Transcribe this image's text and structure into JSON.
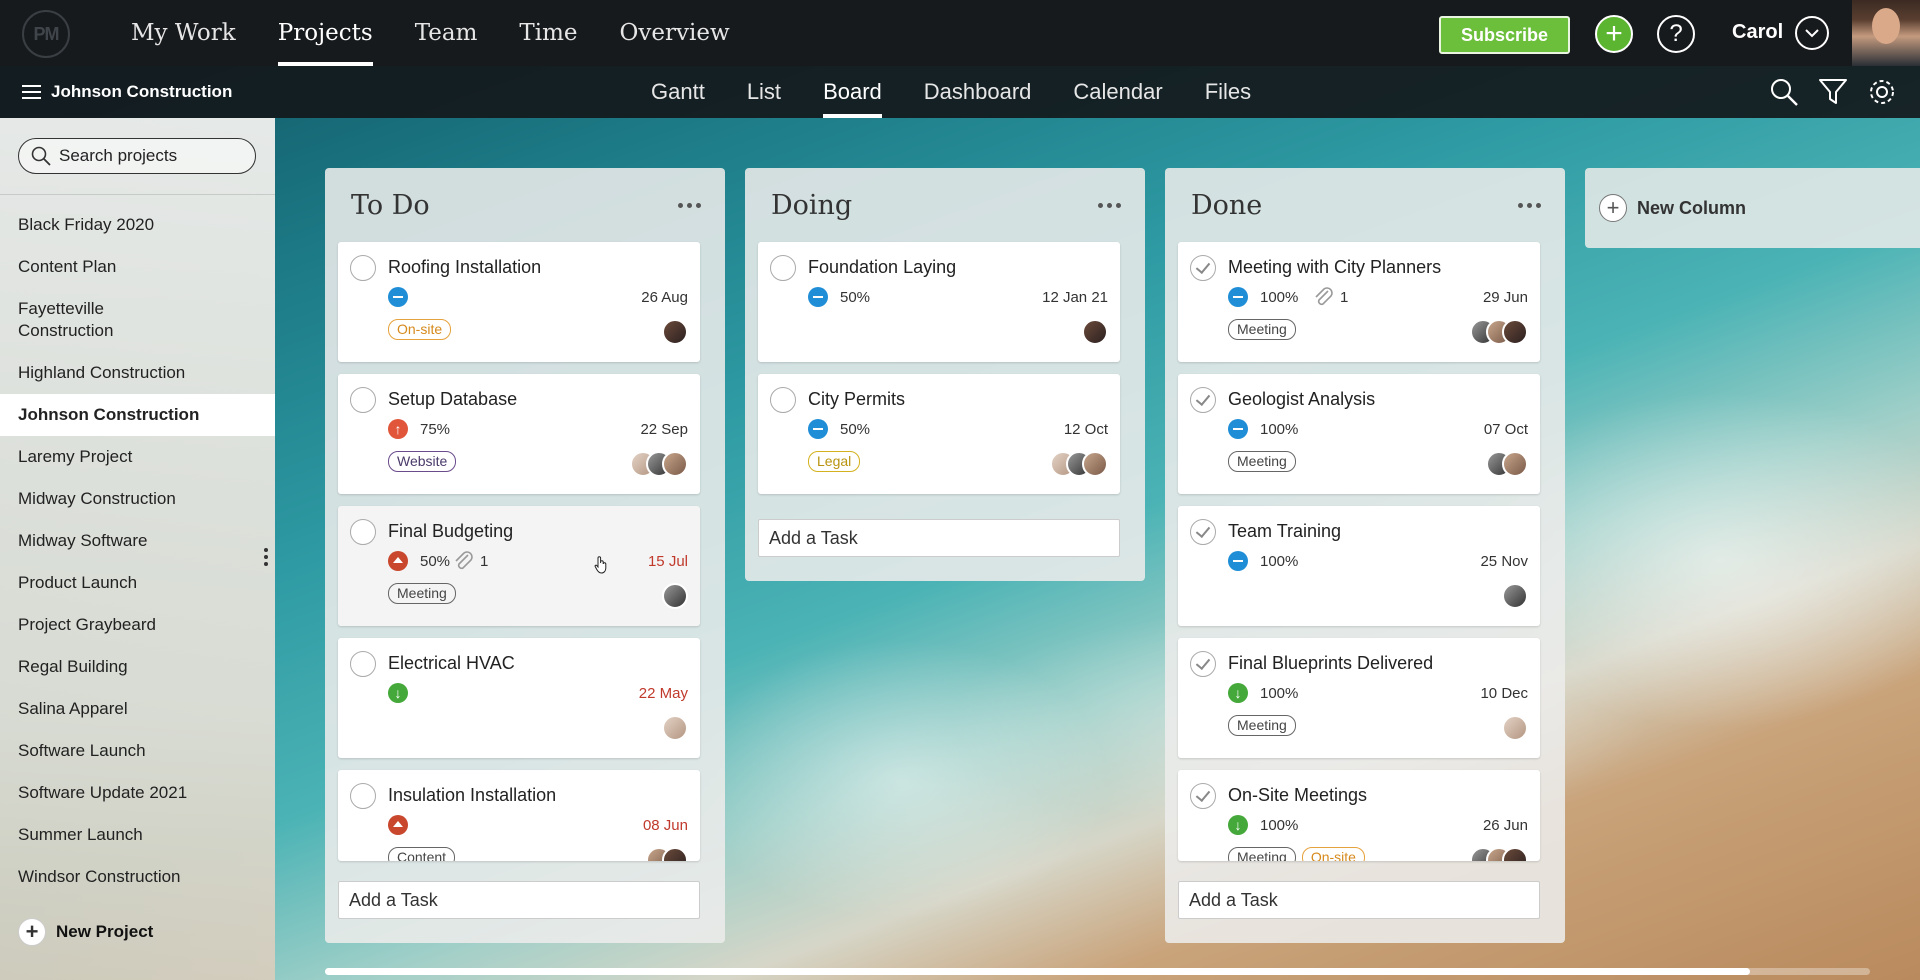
{
  "topnav": {
    "logo": "PM",
    "items": [
      "My Work",
      "Projects",
      "Team",
      "Time",
      "Overview"
    ],
    "active": "Projects",
    "subscribe_label": "Subscribe",
    "user_name": "Carol"
  },
  "subbar": {
    "project_title": "Johnson Construction",
    "tabs": [
      "Gantt",
      "List",
      "Board",
      "Dashboard",
      "Calendar",
      "Files"
    ],
    "active": "Board"
  },
  "sidebar": {
    "search_placeholder": "Search projects",
    "projects": [
      "Black Friday 2020",
      "Content Plan",
      "Fayetteville Construction",
      "Highland Construction",
      "Johnson Construction",
      "Laremy Project",
      "Midway Construction",
      "Midway Software",
      "Product Launch",
      "Project Graybeard",
      "Regal Building",
      "Salina Apparel",
      "Software Launch",
      "Software Update 2021",
      "Summer Launch",
      "Windsor Construction"
    ],
    "active_project": "Johnson Construction",
    "new_project_label": "New Project"
  },
  "board": {
    "add_task_label": "Add a Task",
    "new_column_label": "New Column",
    "columns": [
      {
        "title": "To Do",
        "cards": [
          {
            "title": "Roofing Installation",
            "priority": "medium",
            "percent": "",
            "attachments": "",
            "due": "26 Aug",
            "late": false,
            "tags": [
              "On-site"
            ]
          },
          {
            "title": "Setup Database",
            "priority": "highest",
            "percent": "75%",
            "attachments": "",
            "due": "22 Sep",
            "late": false,
            "tags": [
              "Website"
            ]
          },
          {
            "title": "Final Budgeting",
            "priority": "high",
            "percent": "50%",
            "attachments": "1",
            "due": "15 Jul",
            "late": true,
            "tags": [
              "Meeting"
            ]
          },
          {
            "title": "Electrical HVAC",
            "priority": "low",
            "percent": "",
            "attachments": "",
            "due": "22 May",
            "late": true,
            "tags": []
          },
          {
            "title": "Insulation Installation",
            "priority": "high",
            "percent": "",
            "attachments": "",
            "due": "08 Jun",
            "late": true,
            "tags": [
              "Content"
            ]
          }
        ]
      },
      {
        "title": "Doing",
        "cards": [
          {
            "title": "Foundation Laying",
            "priority": "medium",
            "percent": "50%",
            "attachments": "",
            "due": "12 Jan 21",
            "late": false,
            "tags": []
          },
          {
            "title": "City Permits",
            "priority": "medium",
            "percent": "50%",
            "attachments": "",
            "due": "12 Oct",
            "late": false,
            "tags": [
              "Legal"
            ]
          }
        ]
      },
      {
        "title": "Done",
        "cards": [
          {
            "title": "Meeting with City Planners",
            "priority": "medium",
            "percent": "100%",
            "attachments": "1",
            "due": "29 Jun",
            "late": false,
            "tags": [
              "Meeting"
            ]
          },
          {
            "title": "Geologist Analysis",
            "priority": "medium",
            "percent": "100%",
            "attachments": "",
            "due": "07 Oct",
            "late": false,
            "tags": [
              "Meeting"
            ]
          },
          {
            "title": "Team Training",
            "priority": "medium",
            "percent": "100%",
            "attachments": "",
            "due": "25 Nov",
            "late": false,
            "tags": []
          },
          {
            "title": "Final Blueprints Delivered",
            "priority": "low",
            "percent": "100%",
            "attachments": "",
            "due": "10 Dec",
            "late": false,
            "tags": [
              "Meeting"
            ]
          },
          {
            "title": "On-Site Meetings",
            "priority": "low",
            "percent": "100%",
            "attachments": "",
            "due": "26 Jun",
            "late": false,
            "tags": [
              "Meeting",
              "On-site"
            ]
          }
        ]
      }
    ]
  },
  "colors": {
    "accent_green": "#6bbf3a",
    "priority_medium": "#1f8ed6",
    "priority_high": "#c8472d",
    "priority_low": "#45a83a",
    "late_date": "#c0392b"
  },
  "icons": [
    "hamburger-icon",
    "search-icon",
    "filter-icon",
    "gear-icon",
    "plus-icon",
    "help-icon",
    "chevron-down-icon",
    "paperclip-icon",
    "kebab-icon"
  ]
}
